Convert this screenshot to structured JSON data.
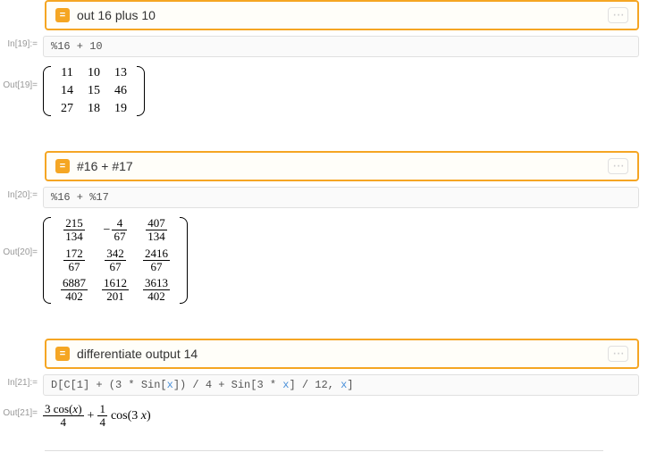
{
  "cells": [
    {
      "nl_query": "out 16 plus 10",
      "in_label": "In[19]:=",
      "code_plain": "%16 + 10",
      "out_label": "Out[19]=",
      "matrix_int": [
        [
          "11",
          "10",
          "13"
        ],
        [
          "14",
          "15",
          "46"
        ],
        [
          "27",
          "18",
          "19"
        ]
      ]
    },
    {
      "nl_query": "#16 + #17",
      "in_label": "In[20]:=",
      "code_plain": "%16 + %17",
      "out_label": "Out[20]=",
      "matrix_frac": [
        [
          {
            "n": "215",
            "d": "134"
          },
          {
            "neg": true,
            "n": "4",
            "d": "67"
          },
          {
            "n": "407",
            "d": "134"
          }
        ],
        [
          {
            "n": "172",
            "d": "67"
          },
          {
            "n": "342",
            "d": "67"
          },
          {
            "n": "2416",
            "d": "67"
          }
        ],
        [
          {
            "n": "6887",
            "d": "402"
          },
          {
            "n": "1612",
            "d": "201"
          },
          {
            "n": "3613",
            "d": "402"
          }
        ]
      ]
    },
    {
      "nl_query": "differentiate output 14",
      "in_label": "In[21]:=",
      "code_html": "D[C[1] + (3 * Sin[<span class=\"var\">x</span>]) / 4 + Sin[3 * <span class=\"var\">x</span>] / 12, <span class=\"var\">x</span>]",
      "out_label": "Out[21]=",
      "expr": {
        "t1_num": "3 cos(x)",
        "t1_den": "4",
        "plus": "+",
        "t2_num": "1",
        "t2_den": "4",
        "t2_tail": "cos(3 x)"
      }
    }
  ],
  "more_glyph": "···",
  "nl_icon_glyph": "="
}
